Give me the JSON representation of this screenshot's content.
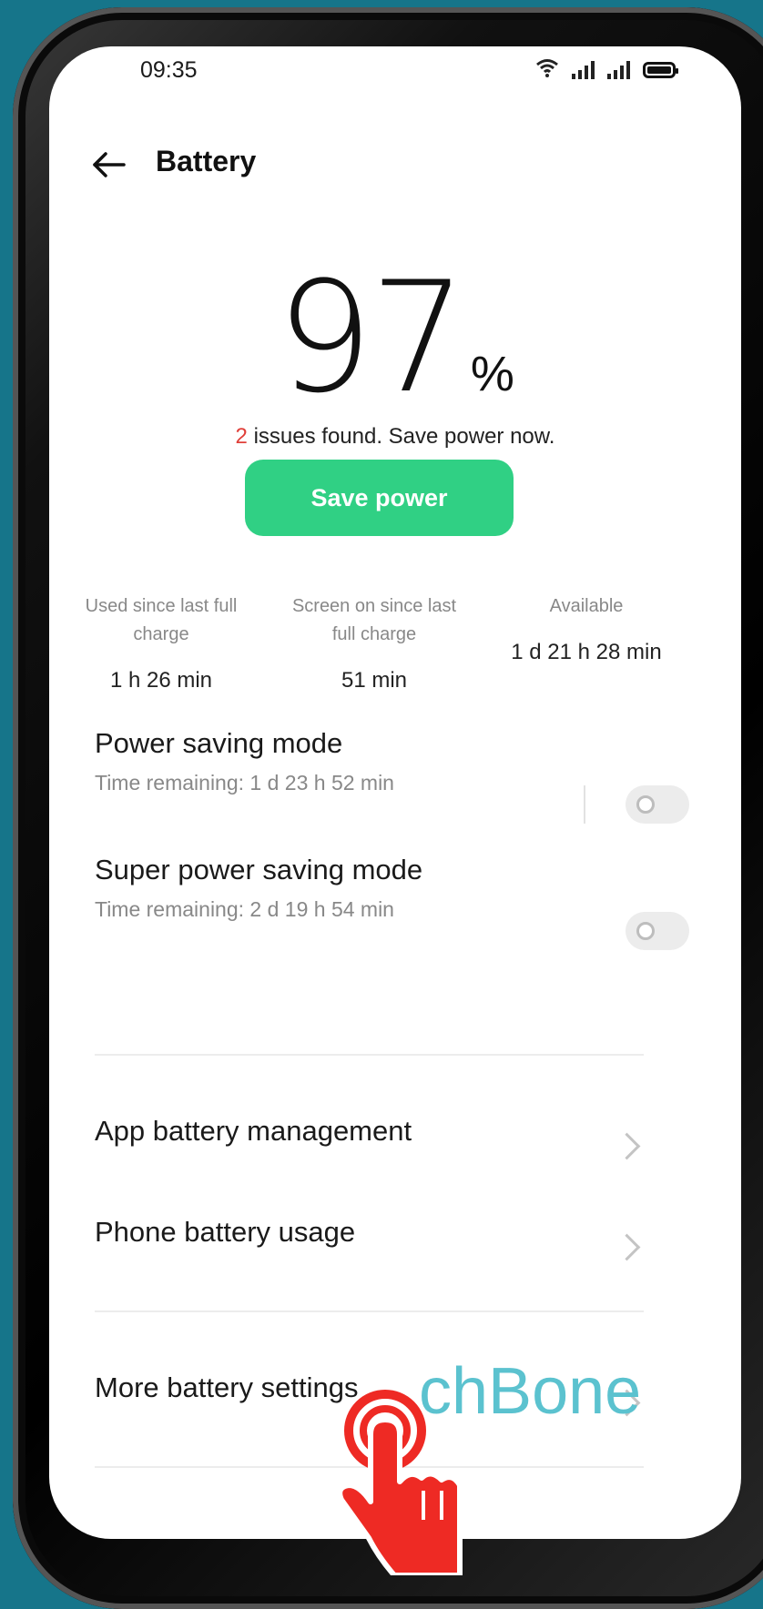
{
  "status_bar": {
    "time": "09:35"
  },
  "header": {
    "title": "Battery"
  },
  "battery": {
    "percent": "97",
    "percent_sign": "%",
    "issues_count": "2",
    "issues_text": " issues found. Save power now.",
    "save_button": "Save power"
  },
  "stats": [
    {
      "label_line1": "Used since last full",
      "label_line2": "charge",
      "value": "1 h 26 min"
    },
    {
      "label_line1": "Screen on since last",
      "label_line2": "full charge",
      "value": "51 min"
    },
    {
      "label_line1": "Available",
      "label_line2": "",
      "value": "1 d 21 h 28 min"
    }
  ],
  "modes": [
    {
      "title": "Power saving mode",
      "subtitle": "Time remaining:  1 d 23 h 52 min",
      "enabled": false
    },
    {
      "title": "Super power saving mode",
      "subtitle": "Time remaining:  2 d 19 h 54 min",
      "enabled": false
    }
  ],
  "menu": {
    "app_battery_management": "App battery management",
    "phone_battery_usage": "Phone battery usage",
    "more_battery_settings": "More battery settings"
  },
  "watermark": {
    "text": "chBone",
    "color": "#5bc2cf"
  },
  "colors": {
    "accent": "#30d084",
    "issue_count": "#e0403a",
    "background": "#16758a"
  },
  "icons": [
    "back-arrow-icon",
    "wifi-icon",
    "signal-icon",
    "battery-icon",
    "chevron-right-icon",
    "tap-hand-icon"
  ]
}
